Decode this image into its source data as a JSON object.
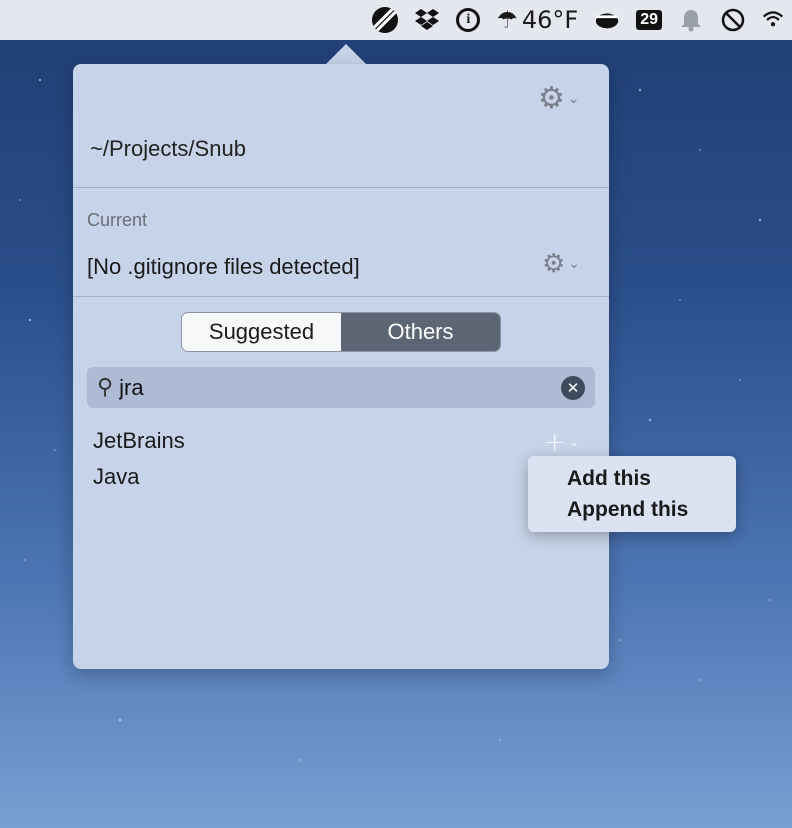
{
  "menubar": {
    "temperature": "46°F",
    "calendar_day": "29",
    "icons": [
      "snub-icon",
      "dropbox-icon",
      "password-icon",
      "weather-icon",
      "coffee-icon",
      "calendar-icon",
      "notification-bell-icon",
      "timer-icon",
      "wifi-icon"
    ]
  },
  "popover": {
    "project_path": "~/Projects/Snub",
    "current": {
      "label": "Current",
      "value": "[No .gitignore files detected]"
    },
    "tabs": [
      {
        "label": "Suggested",
        "selected": false
      },
      {
        "label": "Others",
        "selected": true
      }
    ],
    "search": {
      "value": "jra",
      "placeholder": ""
    },
    "results": [
      {
        "label": "JetBrains"
      },
      {
        "label": "Java"
      }
    ]
  },
  "context_menu": {
    "items": [
      {
        "label": "Add this"
      },
      {
        "label": "Append this"
      }
    ]
  },
  "colors": {
    "popover_bg": "#c7d3e8",
    "segmented_selected": "#5c6573",
    "search_bg": "#aebbd4"
  }
}
